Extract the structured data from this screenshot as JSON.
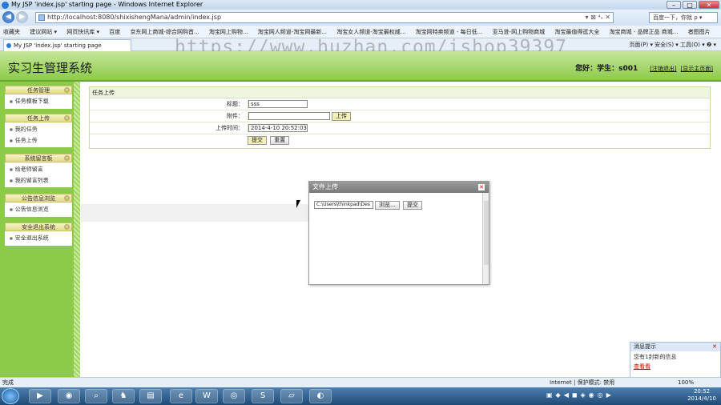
{
  "window": {
    "title": "My JSP 'index.jsp' starting page - Windows Internet Explorer"
  },
  "address": {
    "url": "http://localhost:8080/shixishengMana/admin/index.jsp",
    "tools": "▾ ⊠ ⁴ₙ ✕"
  },
  "search": {
    "placeholder": "百度一下，你就 ρ ▾"
  },
  "favorites": [
    "收藏夹",
    "建议网站 ▾",
    "网页快讯库 ▾",
    "百度",
    "京东网上商城-综合网购首...",
    "淘宝网上购物...",
    "淘宝网人频道-淘宝网最新...",
    "淘宝女人频道-淘宝最权威...",
    "淘宝网特卖频道 - 每日低...",
    "亚马逊-网上购物商城",
    "淘宝最值得逛大全",
    "淘宝商城 - 品牌正品 商城...",
    "者图图片"
  ],
  "tab": {
    "label": "My JSP 'index.jsp' starting page"
  },
  "tabtools": "页面(P) ▾  安全(S) ▾  工具(O) ▾  ❷ ▾",
  "watermark": "https://www.huzhan.com/ishop39397",
  "app": {
    "title": "实习生管理系统",
    "greeting": "您好：学生：s001",
    "logout": "[注销退出]",
    "home": "[显示主页面]"
  },
  "sidebar": [
    {
      "title": "任务管理",
      "items": [
        "任务模板下载"
      ]
    },
    {
      "title": "任务上传",
      "items": [
        "我的任务",
        "任务上传"
      ]
    },
    {
      "title": "系统留言板",
      "items": [
        "给老师留言",
        "我的留言列表"
      ]
    },
    {
      "title": "公告信息浏览",
      "items": [
        "公告信息浏览"
      ]
    },
    {
      "title": "安全退出系统",
      "items": [
        "安全退出系统"
      ]
    }
  ],
  "form": {
    "title": "任务上传",
    "title_label": "标题：",
    "title_value": "sss",
    "attach_label": "附件：",
    "attach_value": "",
    "upload_button": "上传",
    "time_label": "上传时间：",
    "time_value": "2014-4-10 20:52:03",
    "submit_button": "提交",
    "reset_button": "重置"
  },
  "dialog": {
    "title": "文件上传",
    "file_path": "C:\\Users\\thinkpad\\Des",
    "browse_button": "浏览...",
    "submit_button": "提交"
  },
  "notify": {
    "title": "消息提示",
    "message": "您有1封新的信息",
    "link": "查看看"
  },
  "status": {
    "left": "完成",
    "zone": "Internet | 保护模式: 禁用",
    "zoom": "100%"
  },
  "taskbar": {
    "time": "20:52",
    "date": "2014/4/10"
  }
}
